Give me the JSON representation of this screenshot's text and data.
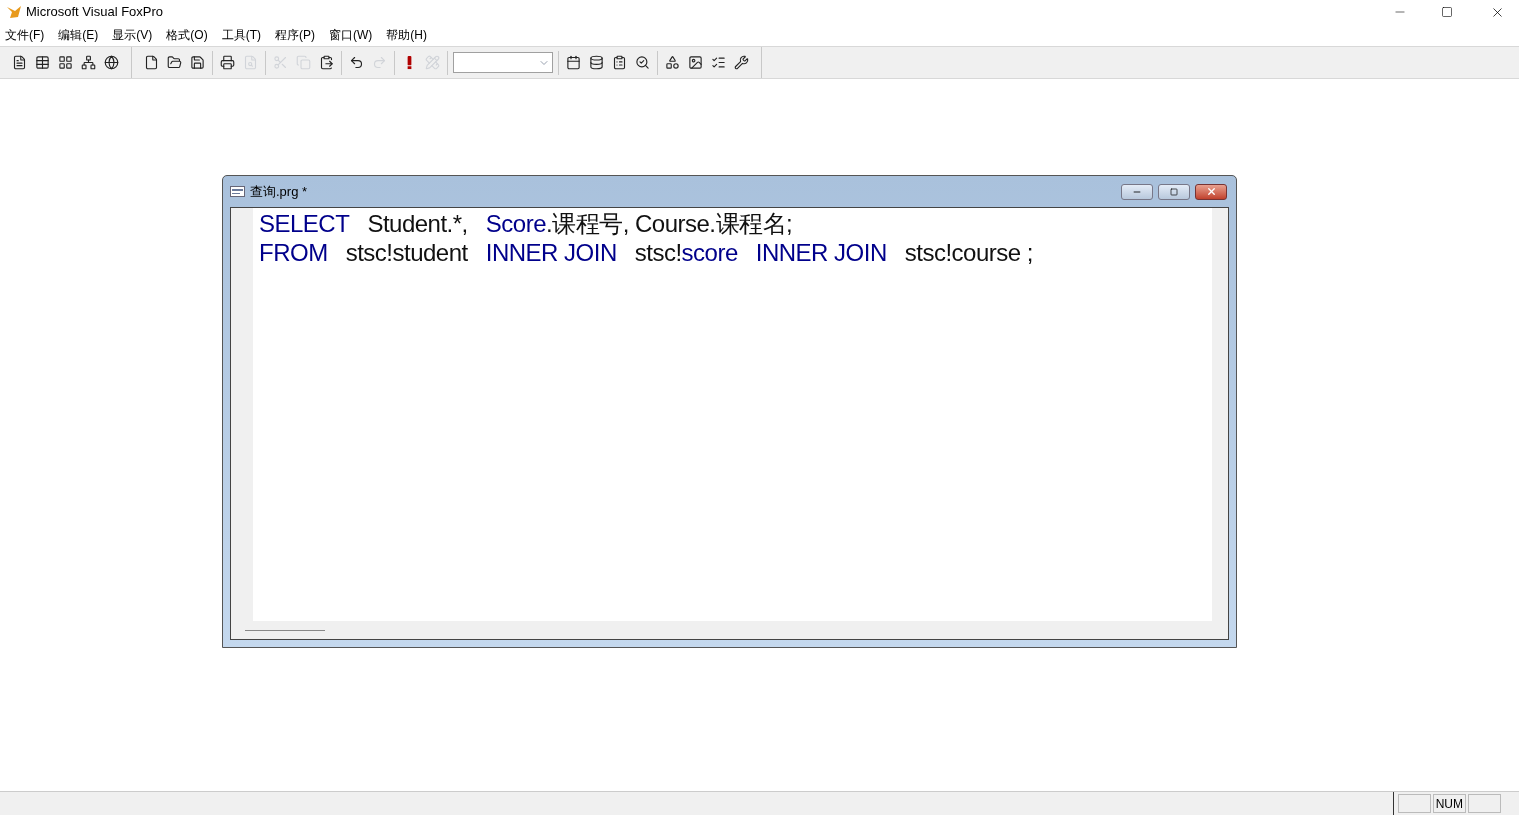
{
  "app_title": "Microsoft Visual FoxPro",
  "menu": [
    "文件(F)",
    "编辑(E)",
    "显示(V)",
    "格式(O)",
    "工具(T)",
    "程序(P)",
    "窗口(W)",
    "帮助(H)"
  ],
  "toolbar_groups": [
    [
      {
        "disabled": false
      },
      {
        "disabled": false
      },
      {
        "disabled": false
      },
      {
        "disabled": false
      },
      {
        "disabled": false
      }
    ],
    [
      {
        "disabled": false
      },
      {
        "disabled": false
      },
      {
        "disabled": false
      }
    ],
    [
      {
        "disabled": false
      },
      {
        "disabled": true
      }
    ],
    [
      {
        "disabled": true
      },
      {
        "disabled": true
      },
      {
        "disabled": false
      }
    ],
    [
      {
        "disabled": false
      },
      {
        "disabled": true
      }
    ],
    [
      {
        "disabled": false
      },
      {
        "disabled": true
      }
    ]
  ],
  "toolbar_tail": [
    [
      {
        "disabled": false
      },
      {
        "disabled": false
      },
      {
        "disabled": false
      },
      {
        "disabled": false
      }
    ],
    [
      {
        "disabled": false
      },
      {
        "disabled": false
      },
      {
        "disabled": false
      },
      {
        "disabled": false
      }
    ]
  ],
  "editor_window": {
    "title": "查询.prg *",
    "lines": [
      [
        [
          {
            "text": "SELECT",
            "kind": "keyword"
          }
        ],
        [
          {
            "text": "Student.*,",
            "kind": "plain"
          }
        ],
        [
          {
            "text": "Score",
            "kind": "keyword"
          },
          {
            "text": ".课程号, Course.课程名;",
            "kind": "plain"
          }
        ]
      ],
      [
        [
          {
            "text": "FROM",
            "kind": "keyword"
          }
        ],
        [
          {
            "text": "stsc!student",
            "kind": "plain"
          }
        ],
        [
          {
            "text": "INNER JOIN",
            "kind": "keyword"
          }
        ],
        [
          {
            "text": "stsc!",
            "kind": "plain"
          },
          {
            "text": "score",
            "kind": "keyword"
          }
        ],
        [
          {
            "text": "INNER JOIN",
            "kind": "keyword"
          }
        ],
        [
          {
            "text": "stsc!course ;",
            "kind": "plain"
          }
        ]
      ]
    ]
  },
  "status_bar": {
    "panels": [
      {
        "kind": "blank"
      },
      {
        "kind": "text",
        "text": "NUM"
      },
      {
        "kind": "blank"
      }
    ]
  }
}
